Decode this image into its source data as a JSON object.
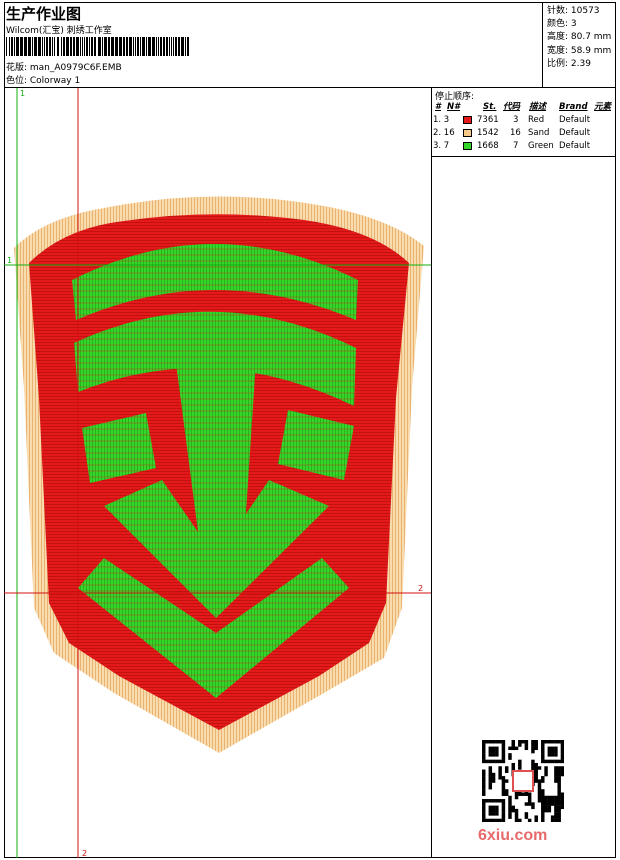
{
  "header": {
    "title": "生产作业图",
    "software": "Wilcom(汇宝) 刺绣工作室",
    "design_label": "花版: man_A0979C6F.EMB",
    "colorway_label": "色位:  Colorway 1"
  },
  "stats": {
    "stitches": "针数: 10573",
    "colors": "颜色: 3",
    "height": "高度: 80.7 mm",
    "width": "宽度: 58.9 mm",
    "scale": "比例: 2.39"
  },
  "stop_sequence": {
    "title": "停止顺序:",
    "headers": [
      "#",
      "N#",
      "St.",
      "代码",
      "描述",
      "Brand",
      "元素"
    ],
    "rows": [
      {
        "idx": "1. 3",
        "st": "7361",
        "code": "3",
        "desc": "Red",
        "brand": "Default",
        "color": "#e41a1a"
      },
      {
        "idx": "2. 16",
        "st": "1542",
        "code": "16",
        "desc": "Sand",
        "brand": "Default",
        "color": "#f6c98a"
      },
      {
        "idx": "3. 7",
        "st": "1668",
        "code": "7",
        "desc": "Green",
        "brand": "Default",
        "color": "#35d62a"
      }
    ]
  },
  "guides": {
    "v1_label": "1",
    "v2_label": "2",
    "h1_label": "1",
    "h2_label": "2"
  },
  "colors": {
    "red": "#e41a1a",
    "sand": "#f6c98a",
    "green": "#35d62a",
    "guide_red": "#d01010",
    "guide_green": "#10b010"
  },
  "watermark": "6xiu.com"
}
